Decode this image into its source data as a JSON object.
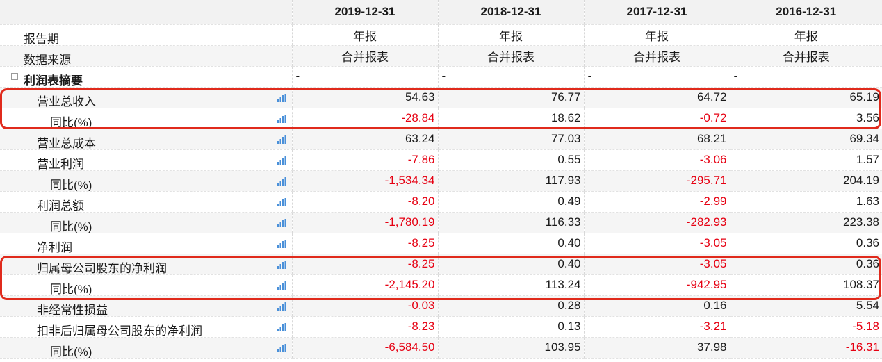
{
  "columns": [
    "2019-12-31",
    "2018-12-31",
    "2017-12-31",
    "2016-12-31"
  ],
  "meta_rows": [
    {
      "label": "报告期",
      "values": [
        "年报",
        "年报",
        "年报",
        "年报"
      ]
    },
    {
      "label": "数据来源",
      "values": [
        "合并报表",
        "合并报表",
        "合并报表",
        "合并报表"
      ]
    }
  ],
  "section": {
    "label": "利润表摘要",
    "values": [
      "-",
      "-",
      "-",
      "-"
    ]
  },
  "rows": [
    {
      "label": "营业总收入",
      "values": [
        "54.63",
        "76.77",
        "64.72",
        "65.19"
      ]
    },
    {
      "label": "同比(%)",
      "values": [
        "-28.84",
        "18.62",
        "-0.72",
        "3.56"
      ]
    },
    {
      "label": "营业总成本",
      "values": [
        "63.24",
        "77.03",
        "68.21",
        "69.34"
      ]
    },
    {
      "label": "营业利润",
      "values": [
        "-7.86",
        "0.55",
        "-3.06",
        "1.57"
      ]
    },
    {
      "label": "同比(%)",
      "values": [
        "-1,534.34",
        "117.93",
        "-295.71",
        "204.19"
      ]
    },
    {
      "label": "利润总额",
      "values": [
        "-8.20",
        "0.49",
        "-2.99",
        "1.63"
      ]
    },
    {
      "label": "同比(%)",
      "values": [
        "-1,780.19",
        "116.33",
        "-282.93",
        "223.38"
      ]
    },
    {
      "label": "净利润",
      "values": [
        "-8.25",
        "0.40",
        "-3.05",
        "0.36"
      ]
    },
    {
      "label": "归属母公司股东的净利润",
      "values": [
        "-8.25",
        "0.40",
        "-3.05",
        "0.36"
      ]
    },
    {
      "label": "同比(%)",
      "values": [
        "-2,145.20",
        "113.24",
        "-942.95",
        "108.37"
      ]
    },
    {
      "label": "非经常性损益",
      "values": [
        "-0.03",
        "0.28",
        "0.16",
        "5.54"
      ]
    },
    {
      "label": "扣非后归属母公司股东的净利润",
      "values": [
        "-8.23",
        "0.13",
        "-3.21",
        "-5.18"
      ]
    },
    {
      "label": "同比(%)",
      "values": [
        "-6,584.50",
        "103.95",
        "37.98",
        "-16.31"
      ]
    }
  ],
  "colors": {
    "negative": "#e60012",
    "highlight_border": "#e02a1c",
    "chart_icon": "#4a90d9"
  },
  "icons": {
    "row_chart": "bar-chart-icon",
    "section_toggle": "collapse-minus-icon"
  }
}
